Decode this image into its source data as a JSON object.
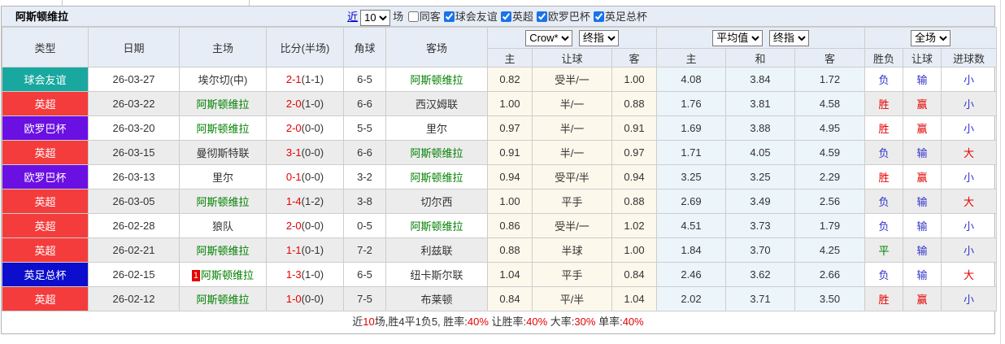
{
  "page_title": "阿斯顿维拉",
  "filters": {
    "recent_link": "近",
    "recent_value": "10",
    "matches_label": "场",
    "same_away_label": "同客",
    "competitions": [
      {
        "label": "球会友谊",
        "checked": true
      },
      {
        "label": "英超",
        "checked": true
      },
      {
        "label": "欧罗巴杯",
        "checked": true
      },
      {
        "label": "英足总杯",
        "checked": true
      }
    ]
  },
  "table": {
    "headers": {
      "type": "类型",
      "date": "日期",
      "home": "主场",
      "score": "比分(半场)",
      "corners": "角球",
      "away": "客场",
      "sub": [
        "主",
        "让球",
        "客",
        "主",
        "和",
        "客",
        "胜负",
        "让球",
        "进球数"
      ]
    },
    "selects": {
      "company": "Crow*",
      "final1": "终指",
      "average": "平均值",
      "final2": "终指",
      "scope": "全场"
    },
    "type_colors": {
      "球会友谊": "#18a89f",
      "英超": "#f43c3c",
      "欧罗巴杯": "#6b10e3",
      "英足总杯": "#0d0dce"
    },
    "result_color_map": {
      "胜": "red",
      "平": "green",
      "负": "blue",
      "赢": "red",
      "输": "blue",
      "大": "red",
      "小": "blue"
    },
    "result_palette": {
      "red": "#e60000",
      "blue": "#3333cc",
      "green": "#008000"
    },
    "self_team": "阿斯顿维拉",
    "rows": [
      {
        "type": "球会友谊",
        "date": "26-03-27",
        "home": "埃尔切(中)",
        "home_is_self": false,
        "score": "2-1",
        "half": "(1-1)",
        "corners": "6-5",
        "away": "阿斯顿维拉",
        "away_is_self": true,
        "odds": [
          "0.82",
          "受半/一",
          "1.00"
        ],
        "avg": [
          "4.08",
          "3.84",
          "1.72"
        ],
        "results": [
          "负",
          "输",
          "小"
        ]
      },
      {
        "type": "英超",
        "date": "26-03-22",
        "home": "阿斯顿维拉",
        "home_is_self": true,
        "score": "2-0",
        "half": "(1-0)",
        "corners": "6-6",
        "away": "西汉姆联",
        "away_is_self": false,
        "odds": [
          "1.00",
          "半/一",
          "0.88"
        ],
        "avg": [
          "1.76",
          "3.81",
          "4.58"
        ],
        "results": [
          "胜",
          "赢",
          "小"
        ]
      },
      {
        "type": "欧罗巴杯",
        "date": "26-03-20",
        "home": "阿斯顿维拉",
        "home_is_self": true,
        "score": "2-0",
        "half": "(0-0)",
        "corners": "5-5",
        "away": "里尔",
        "away_is_self": false,
        "odds": [
          "0.97",
          "半/一",
          "0.91"
        ],
        "avg": [
          "1.69",
          "3.88",
          "4.95"
        ],
        "results": [
          "胜",
          "赢",
          "小"
        ]
      },
      {
        "type": "英超",
        "date": "26-03-15",
        "home": "曼彻斯特联",
        "home_is_self": false,
        "score": "3-1",
        "half": "(0-0)",
        "corners": "6-6",
        "away": "阿斯顿维拉",
        "away_is_self": true,
        "odds": [
          "0.91",
          "半/一",
          "0.97"
        ],
        "avg": [
          "1.71",
          "4.05",
          "4.59"
        ],
        "results": [
          "负",
          "输",
          "大"
        ]
      },
      {
        "type": "欧罗巴杯",
        "date": "26-03-13",
        "home": "里尔",
        "home_is_self": false,
        "score": "0-1",
        "half": "(0-0)",
        "corners": "3-2",
        "away": "阿斯顿维拉",
        "away_is_self": true,
        "odds": [
          "0.94",
          "受平/半",
          "0.94"
        ],
        "avg": [
          "3.25",
          "3.25",
          "2.29"
        ],
        "results": [
          "胜",
          "赢",
          "小"
        ]
      },
      {
        "type": "英超",
        "date": "26-03-05",
        "home": "阿斯顿维拉",
        "home_is_self": true,
        "score": "1-4",
        "half": "(1-2)",
        "corners": "3-8",
        "away": "切尔西",
        "away_is_self": false,
        "odds": [
          "1.00",
          "平手",
          "0.88"
        ],
        "avg": [
          "2.69",
          "3.49",
          "2.56"
        ],
        "results": [
          "负",
          "输",
          "大"
        ]
      },
      {
        "type": "英超",
        "date": "26-02-28",
        "home": "狼队",
        "home_is_self": false,
        "score": "2-0",
        "half": "(0-0)",
        "corners": "0-5",
        "away": "阿斯顿维拉",
        "away_is_self": true,
        "odds": [
          "0.86",
          "受半/一",
          "1.02"
        ],
        "avg": [
          "4.51",
          "3.73",
          "1.79"
        ],
        "results": [
          "负",
          "输",
          "小"
        ]
      },
      {
        "type": "英超",
        "date": "26-02-21",
        "home": "阿斯顿维拉",
        "home_is_self": true,
        "score": "1-1",
        "half": "(0-1)",
        "corners": "7-2",
        "away": "利兹联",
        "away_is_self": false,
        "odds": [
          "0.88",
          "半球",
          "1.00"
        ],
        "avg": [
          "1.84",
          "3.70",
          "4.25"
        ],
        "results": [
          "平",
          "输",
          "小"
        ]
      },
      {
        "type": "英足总杯",
        "date": "26-02-15",
        "home": "阿斯顿维拉",
        "home_is_self": true,
        "home_badge": "1",
        "score": "1-3",
        "half": "(1-0)",
        "corners": "6-5",
        "away": "纽卡斯尔联",
        "away_is_self": false,
        "odds": [
          "1.04",
          "平手",
          "0.84"
        ],
        "avg": [
          "2.46",
          "3.62",
          "2.66"
        ],
        "results": [
          "负",
          "输",
          "大"
        ]
      },
      {
        "type": "英超",
        "date": "26-02-12",
        "home": "阿斯顿维拉",
        "home_is_self": true,
        "score": "1-0",
        "half": "(0-0)",
        "corners": "7-5",
        "away": "布莱顿",
        "away_is_self": false,
        "odds": [
          "0.84",
          "平/半",
          "1.04"
        ],
        "avg": [
          "2.02",
          "3.71",
          "3.50"
        ],
        "results": [
          "胜",
          "赢",
          "小"
        ]
      }
    ],
    "footer_segments": [
      {
        "t": "近",
        "c": "#333333"
      },
      {
        "t": "10",
        "c": "#e60000"
      },
      {
        "t": "场,胜4平1负5, 胜率:",
        "c": "#333333"
      },
      {
        "t": "40%",
        "c": "#e60000"
      },
      {
        "t": " 让胜率:",
        "c": "#333333"
      },
      {
        "t": "40%",
        "c": "#e60000"
      },
      {
        "t": " 大率:",
        "c": "#333333"
      },
      {
        "t": "30%",
        "c": "#e60000"
      },
      {
        "t": " 单率:",
        "c": "#333333"
      },
      {
        "t": "40%",
        "c": "#e60000"
      }
    ]
  }
}
